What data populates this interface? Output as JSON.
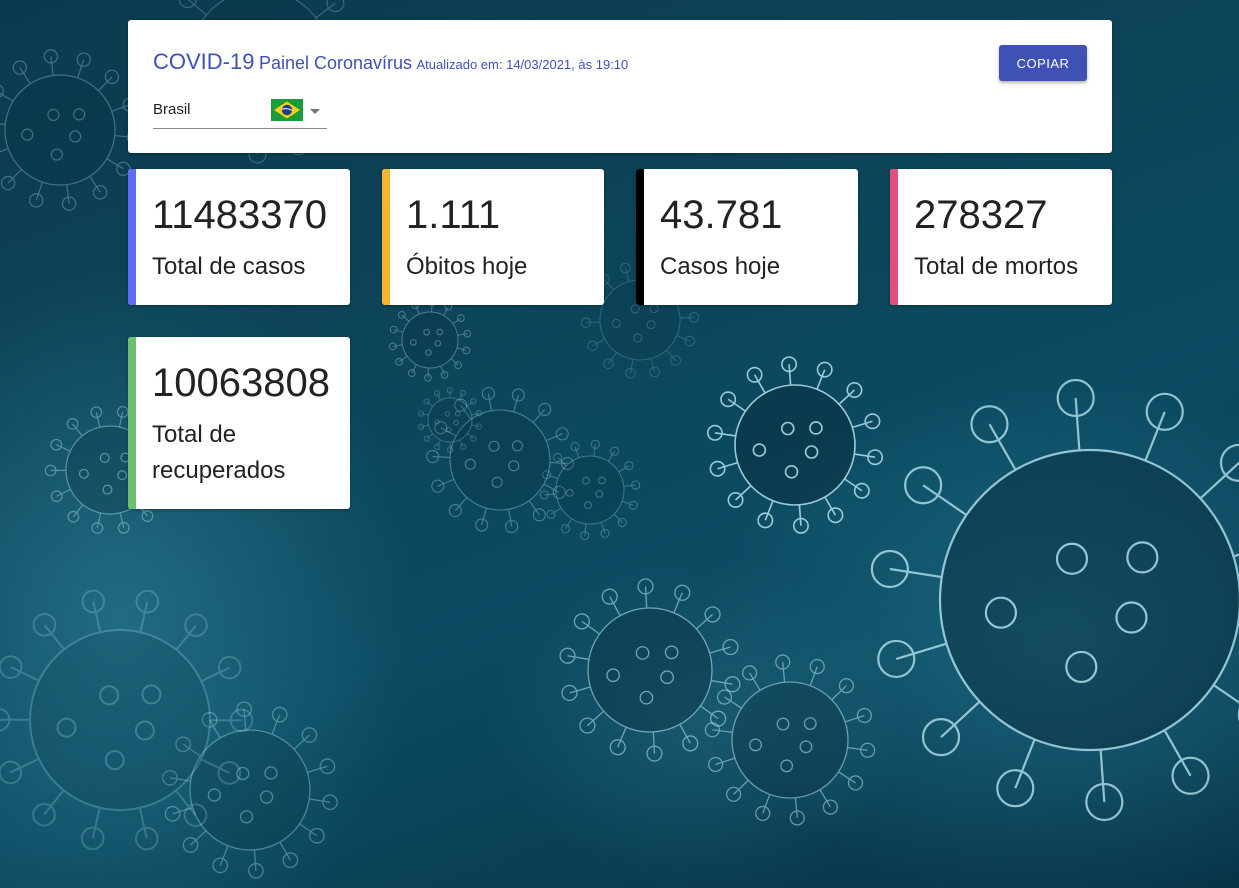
{
  "header": {
    "title_main": "COVID-19",
    "title_sub": "Painel Coronavírus",
    "updated_text": "Atualizado em: 14/03/2021, às 19:10",
    "copy_button_label": "COPIAR",
    "country": {
      "selected": "Brasil",
      "flag_icon": "brazil-flag-icon"
    }
  },
  "cards": [
    {
      "value": "11483370",
      "label": "Total de casos",
      "accent_color": "#5c6bf5"
    },
    {
      "value": "1.111",
      "label": "Óbitos hoje",
      "accent_color": "#f4b630"
    },
    {
      "value": "43.781",
      "label": "Casos hoje",
      "accent_color": "#000000"
    },
    {
      "value": "278327",
      "label": "Total de mortos",
      "accent_color": "#e0507a"
    },
    {
      "value": "10063808",
      "label": "Total de recuperados",
      "accent_color": "#6cc070"
    }
  ],
  "colors": {
    "primary": "#3f51b5",
    "card_text": "#222222"
  }
}
